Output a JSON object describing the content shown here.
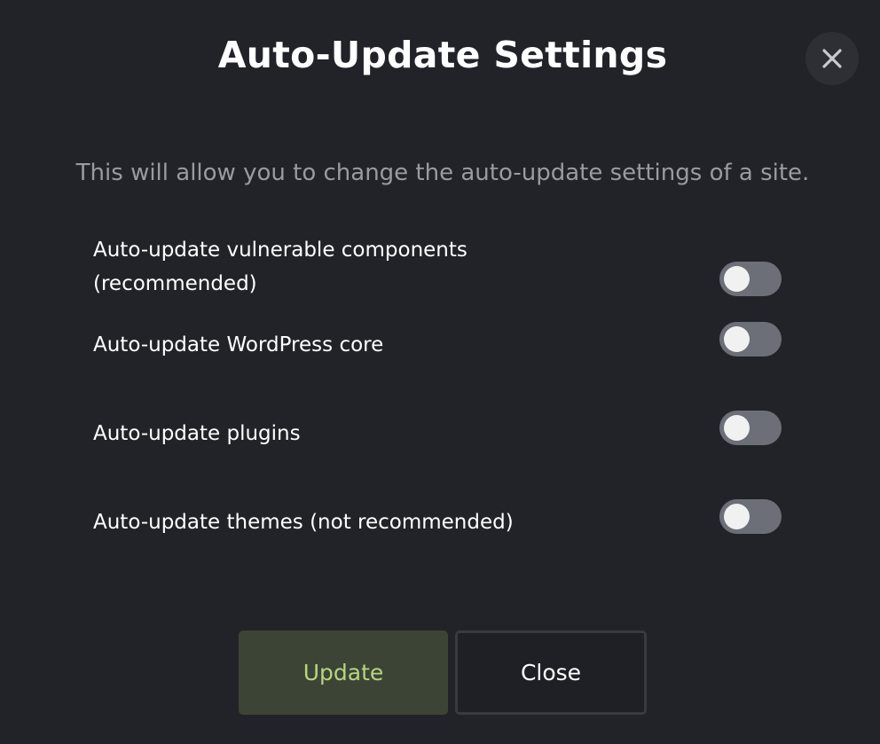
{
  "dialog": {
    "title": "Auto-Update Settings",
    "close_icon": "close-icon",
    "description": "This will allow you to change the auto-update settings of a site."
  },
  "options": [
    {
      "label": "Auto-update vulnerable components (recommended)",
      "enabled": false
    },
    {
      "label": "Auto-update WordPress core",
      "enabled": false
    },
    {
      "label": "Auto-update plugins",
      "enabled": false
    },
    {
      "label": "Auto-update themes (not recommended)",
      "enabled": false
    }
  ],
  "buttons": {
    "update_label": "Update",
    "close_label": "Close"
  },
  "colors": {
    "background": "#222329",
    "toggle_off": "#6c6f77",
    "update_button_bg": "#3c4535",
    "update_button_text": "#b9d480"
  }
}
